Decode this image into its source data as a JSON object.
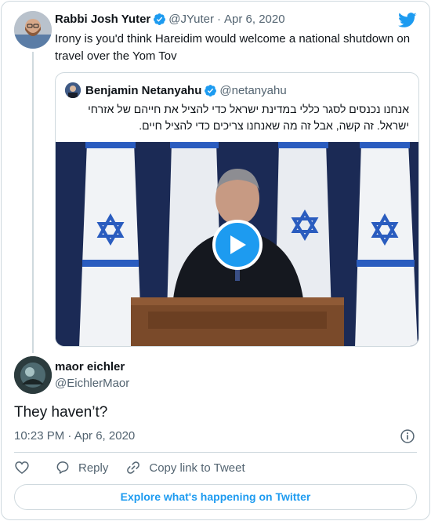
{
  "parent": {
    "name": "Rabbi Josh Yuter",
    "handle": "@JYuter",
    "separator": "·",
    "date": "Apr 6, 2020",
    "text": "Irony is you'd think Hareidim would welcome a national shutdown on travel over the Yom Tov"
  },
  "quote": {
    "name": "Benjamin Netanyahu",
    "handle": "@netanyahu",
    "text": "אנחנו נכנסים לסגר כללי במדינת ישראל כדי להציל את חייהם של אזרחי ישראל. זה קשה, אבל זה מה שאנחנו צריכים כדי להציל חיים."
  },
  "reply": {
    "name": "maor eichler",
    "handle": "@EichlerMaor",
    "text": "They haven’t?",
    "timestamp": "10:23 PM · Apr 6, 2020"
  },
  "actions": {
    "reply_label": "Reply",
    "copy_label": "Copy link to Tweet"
  },
  "footer": {
    "explore_label": "Explore what's happening on Twitter"
  },
  "colors": {
    "accent": "#1d9bf0",
    "secondary_text": "#536471",
    "border": "#cfd9de"
  },
  "icons": [
    "twitter-bird-icon",
    "verified-badge-icon",
    "play-icon",
    "info-icon",
    "heart-icon",
    "reply-bubble-icon",
    "link-icon"
  ]
}
